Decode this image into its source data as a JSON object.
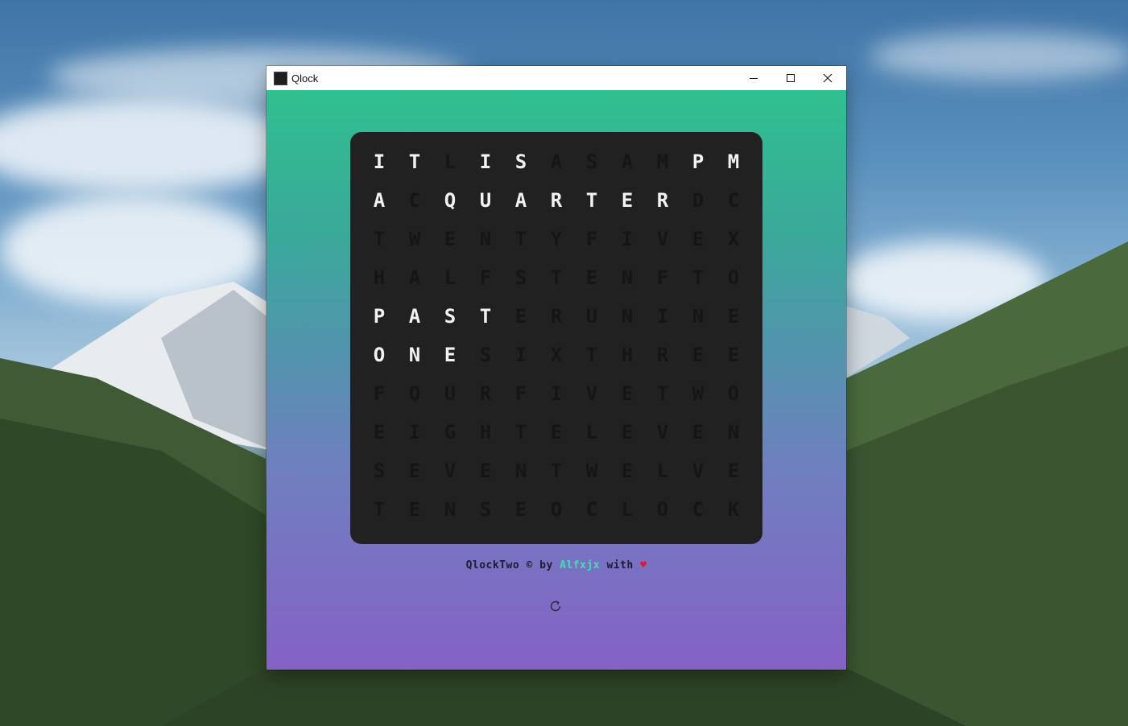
{
  "window": {
    "title": "Qlock"
  },
  "clock": {
    "rows": [
      "ITLISASAMPM",
      "ACQUARTERDC",
      "TWENTYFIVEX",
      "HALFSTENFTO",
      "PASTERUNINE",
      "ONESIXTHREE",
      "FOURFIVETWO",
      "EIGHTELEVEN",
      "SEVENTWELVE",
      "TENSEOCLOCK"
    ],
    "lit": [
      [
        0,
        0
      ],
      [
        0,
        1
      ],
      [
        0,
        3
      ],
      [
        0,
        4
      ],
      [
        0,
        9
      ],
      [
        0,
        10
      ],
      [
        1,
        0
      ],
      [
        1,
        2
      ],
      [
        1,
        3
      ],
      [
        1,
        4
      ],
      [
        1,
        5
      ],
      [
        1,
        6
      ],
      [
        1,
        7
      ],
      [
        1,
        8
      ],
      [
        4,
        0
      ],
      [
        4,
        1
      ],
      [
        4,
        2
      ],
      [
        4,
        3
      ],
      [
        5,
        0
      ],
      [
        5,
        1
      ],
      [
        5,
        2
      ]
    ]
  },
  "footer": {
    "prefix": "QlockTwo © by ",
    "author": "Alfxjx",
    "with": " with ",
    "heart": "♥"
  },
  "icons": {
    "refresh": "refresh-icon",
    "minimize": "minimize-icon",
    "maximize": "maximize-icon",
    "close": "close-icon"
  },
  "colors": {
    "gradient_top": "#2fc08f",
    "gradient_bottom": "#8561c6",
    "board": "#212121",
    "lit_letter": "#f2f2f2",
    "unlit_letter": "#151515",
    "author": "#3ee0b0",
    "heart": "#e0192a"
  }
}
